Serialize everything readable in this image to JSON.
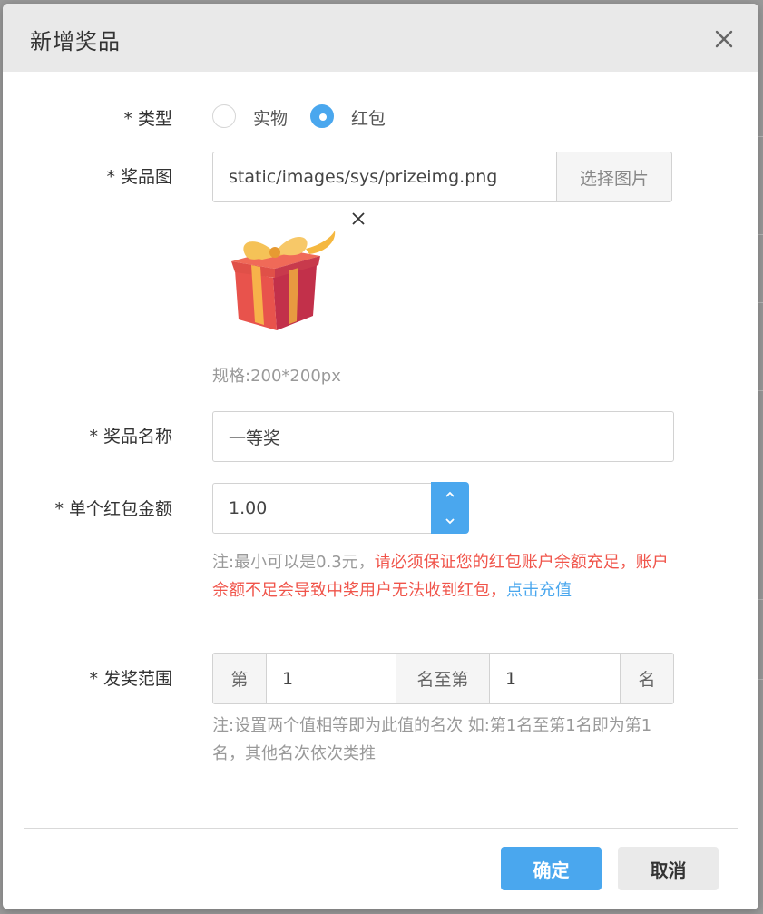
{
  "dialog": {
    "title": "新增奖品",
    "close_icon": "close-icon"
  },
  "form": {
    "type": {
      "label": "* 类型",
      "options": [
        {
          "label": "实物",
          "checked": false
        },
        {
          "label": "红包",
          "checked": true
        }
      ]
    },
    "image": {
      "label": "* 奖品图",
      "value": "static/images/sys/prizeimg.png",
      "pick_label": "选择图片",
      "remove_icon": "close-icon",
      "preview_icon": "gift-icon",
      "spec": "规格:200*200px"
    },
    "name": {
      "label": "* 奖品名称",
      "value": "一等奖"
    },
    "amount": {
      "label": "* 单个红包金额",
      "value": "1.00",
      "up_icon": "chevron-up-icon",
      "down_icon": "chevron-down-icon",
      "hint_prefix": "注:最小可以是0.3元，",
      "hint_warn": "请必须保证您的红包账户余额充足，账户余额不足会导致中奖用户无法收到红包，",
      "hint_link": "点击充值"
    },
    "range": {
      "label": "* 发奖范围",
      "prefix": "第",
      "from_value": "1",
      "middle": "名至第",
      "to_value": "1",
      "suffix": "名",
      "hint": "注:设置两个值相等即为此值的名次 如:第1名至第1名即为第1名，其他名次依次类推"
    }
  },
  "footer": {
    "ok_label": "确定",
    "cancel_label": "取消"
  },
  "colors": {
    "accent": "#4aa7ee",
    "warn": "#f0544a",
    "header_bg": "#e9e9e9"
  }
}
